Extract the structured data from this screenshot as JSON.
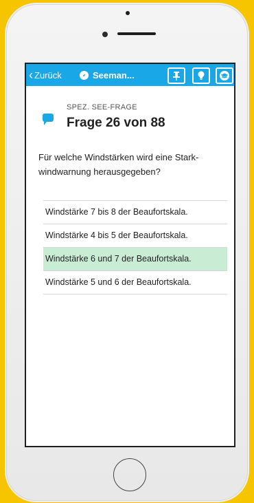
{
  "colors": {
    "brand": "#1aa7e8",
    "correct": "#c9ecd5",
    "frame": "#f7c400"
  },
  "navbar": {
    "back_label": "Zurück",
    "app_title": "Seeman...",
    "icons": [
      "pin-icon",
      "bulb-icon",
      "graduation-cap-icon"
    ]
  },
  "question": {
    "category": "SPEZ. SEE-FRAGE",
    "counter": "Frage 26 von 88",
    "text": "Für welche Windstärken wird eine Stark-windwarnung herausgegeben?"
  },
  "answers": [
    {
      "text": "Windstärke 7 bis 8 der Beaufortskala.",
      "state": "default"
    },
    {
      "text": "Windstärke 4 bis 5 der Beaufortskala.",
      "state": "default"
    },
    {
      "text": "Windstärke 6 und 7 der Beaufortskala.",
      "state": "correct"
    },
    {
      "text": "Windstärke 5 und 6 der Beaufortskala.",
      "state": "default"
    }
  ]
}
